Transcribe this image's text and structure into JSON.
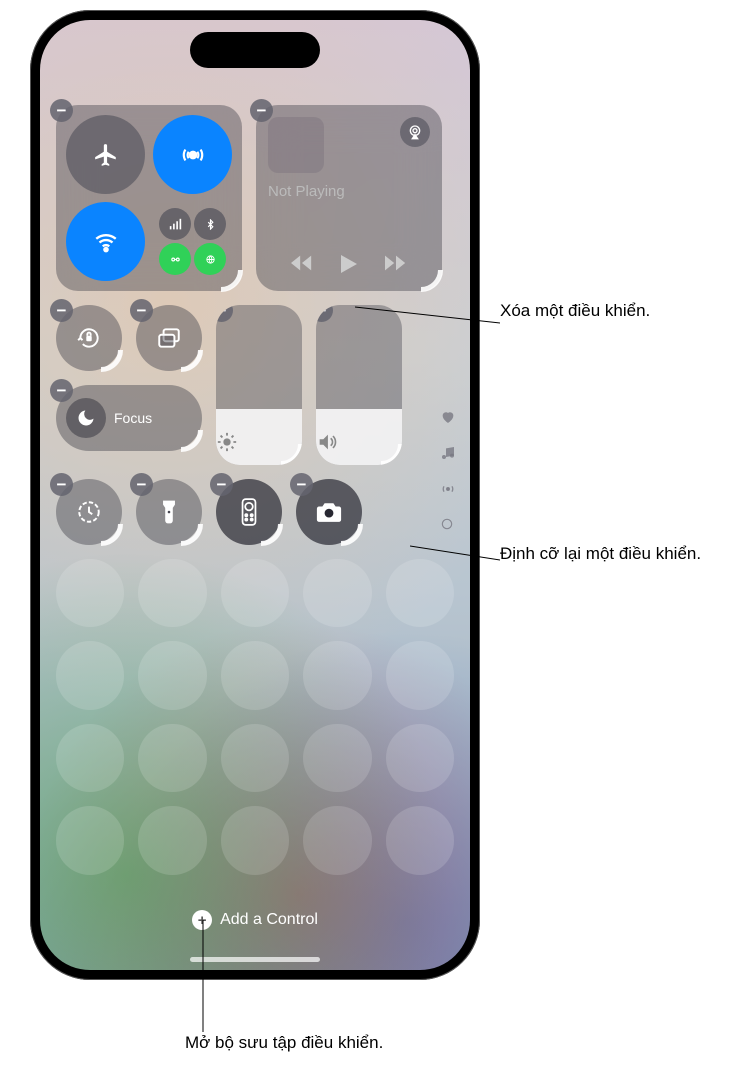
{
  "media": {
    "status": "Not Playing"
  },
  "focus": {
    "label": "Focus"
  },
  "brightness": {
    "fill_percent": 35
  },
  "volume": {
    "fill_percent": 35
  },
  "add_control": {
    "label": "Add a Control"
  },
  "callouts": {
    "delete": "Xóa một điều khiển.",
    "resize": "Định cỡ lại một điều khiển.",
    "gallery": "Mở bộ sưu tập điều khiển."
  }
}
